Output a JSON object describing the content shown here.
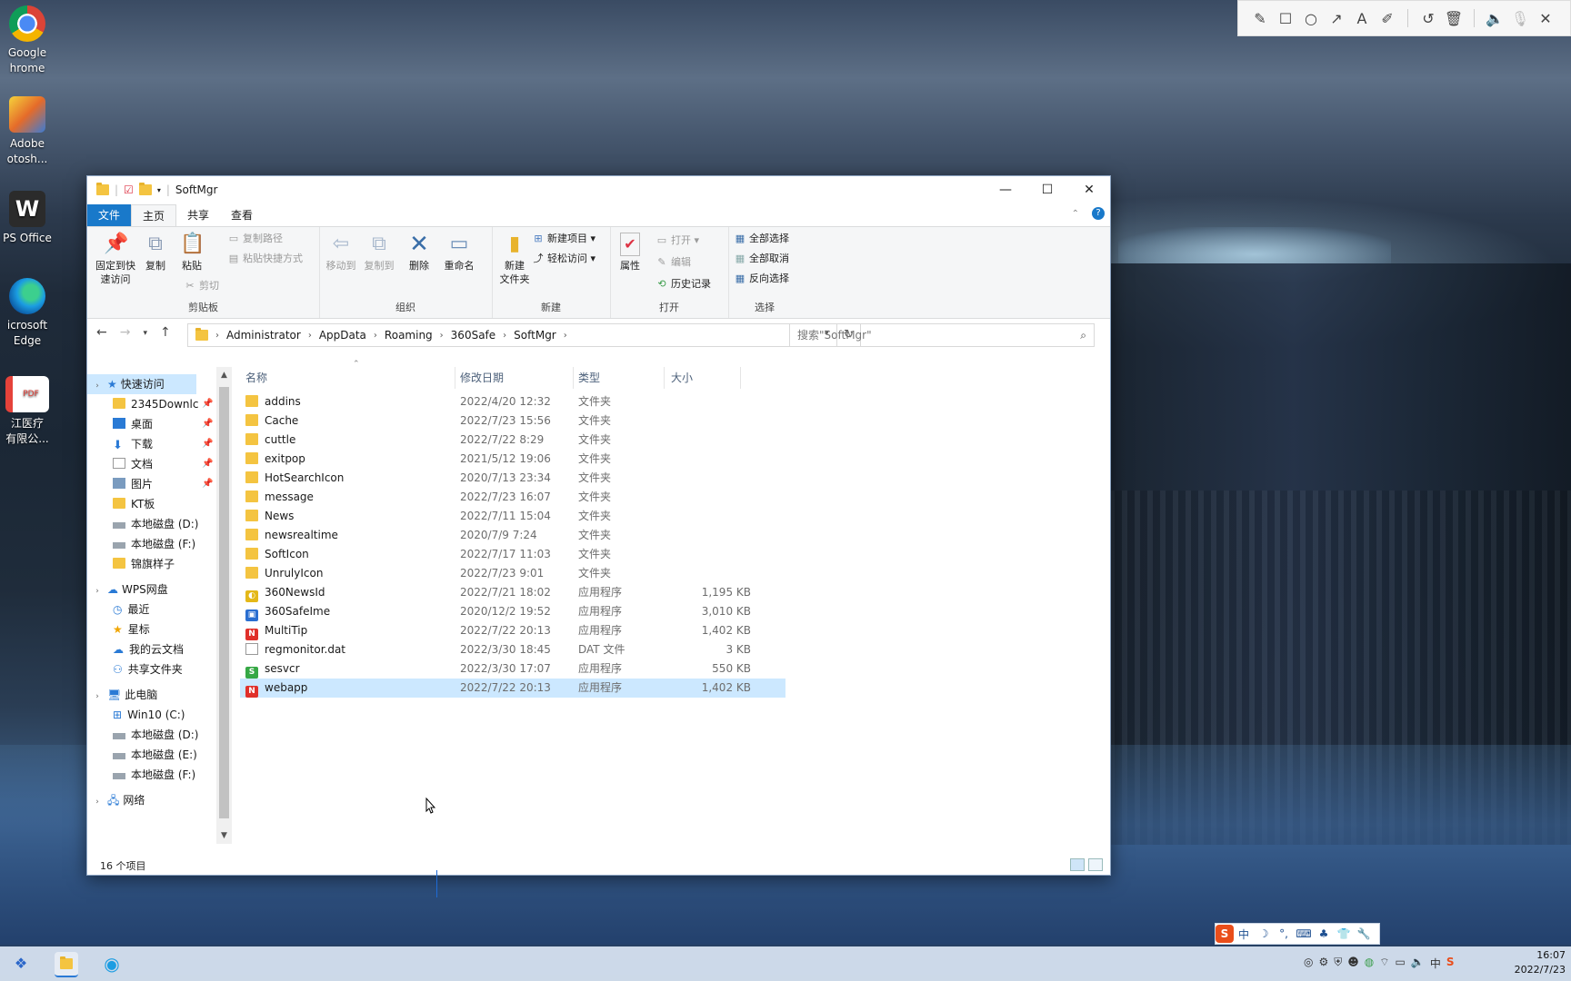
{
  "desktop": {
    "icons": [
      {
        "label": "Google Chrome",
        "lines": [
          "Google",
          "hrome"
        ]
      },
      {
        "label": "Adobe Photoshop",
        "lines": [
          "Adobe",
          "otosh..."
        ]
      },
      {
        "label": "WPS Office",
        "lines": [
          "PS Office"
        ]
      },
      {
        "label": "Microsoft Edge",
        "lines": [
          "icrosoft",
          "Edge"
        ]
      },
      {
        "label": "PDF",
        "lines": [
          "江医疗",
          "有限公..."
        ]
      }
    ]
  },
  "annotation_toolbar": {
    "tools": [
      "pencil-icon",
      "rectangle-icon",
      "ellipse-icon",
      "arrow-icon",
      "text-icon",
      "marker-icon",
      "undo-icon",
      "delete-icon",
      "volume-icon",
      "mic-icon",
      "close-icon"
    ]
  },
  "window": {
    "title": "SoftMgr",
    "tabs": {
      "file": "文件",
      "home": "主页",
      "share": "共享",
      "view": "查看"
    },
    "ribbon": {
      "clipboard": {
        "name": "剪贴板",
        "pin_label_1": "固定到快",
        "pin_label_2": "速访问",
        "copy": "复制",
        "paste": "粘贴",
        "copy_path": "复制路径",
        "paste_shortcut": "粘贴快捷方式",
        "cut": "剪切"
      },
      "organize": {
        "name": "组织",
        "move_to": "移动到",
        "copy_to": "复制到",
        "delete": "删除",
        "rename": "重命名"
      },
      "new": {
        "name": "新建",
        "new_folder_1": "新建",
        "new_folder_2": "文件夹",
        "new_item": "新建项目",
        "easy_access": "轻松访问"
      },
      "open": {
        "name": "打开",
        "properties": "属性",
        "open": "打开",
        "edit": "编辑",
        "history": "历史记录"
      },
      "select": {
        "name": "选择",
        "select_all": "全部选择",
        "select_none": "全部取消",
        "invert": "反向选择"
      }
    },
    "address": {
      "crumbs": [
        "Administrator",
        "AppData",
        "Roaming",
        "360Safe",
        "SoftMgr"
      ],
      "search_placeholder": "搜索\"SoftMgr\""
    },
    "nav_pane": {
      "quick_access": "快速访问",
      "quick_items": [
        {
          "label": "2345Downlc",
          "pinned": true
        },
        {
          "label": "桌面",
          "pinned": true
        },
        {
          "label": "下载",
          "pinned": true
        },
        {
          "label": "文档",
          "pinned": true
        },
        {
          "label": "图片",
          "pinned": true
        },
        {
          "label": "KT板",
          "pinned": false
        },
        {
          "label": "本地磁盘 (D:)",
          "pinned": false
        },
        {
          "label": "本地磁盘 (F:)",
          "pinned": false
        },
        {
          "label": "锦旗样子",
          "pinned": false
        }
      ],
      "wps": "WPS网盘",
      "wps_items": [
        "最近",
        "星标",
        "我的云文档",
        "共享文件夹"
      ],
      "this_pc": "此电脑",
      "pc_items": [
        "Win10 (C:)",
        "本地磁盘 (D:)",
        "本地磁盘 (E:)",
        "本地磁盘 (F:)"
      ],
      "network": "网络"
    },
    "columns": {
      "name": "名称",
      "date": "修改日期",
      "type": "类型",
      "size": "大小"
    },
    "files": [
      {
        "name": "addins",
        "date": "2022/4/20 12:32",
        "type": "文件夹",
        "size": "",
        "kind": "folder"
      },
      {
        "name": "Cache",
        "date": "2022/7/23 15:56",
        "type": "文件夹",
        "size": "",
        "kind": "folder"
      },
      {
        "name": "cuttle",
        "date": "2022/7/22 8:29",
        "type": "文件夹",
        "size": "",
        "kind": "folder"
      },
      {
        "name": "exitpop",
        "date": "2021/5/12 19:06",
        "type": "文件夹",
        "size": "",
        "kind": "folder"
      },
      {
        "name": "HotSearchIcon",
        "date": "2020/7/13 23:34",
        "type": "文件夹",
        "size": "",
        "kind": "folder"
      },
      {
        "name": "message",
        "date": "2022/7/23 16:07",
        "type": "文件夹",
        "size": "",
        "kind": "folder"
      },
      {
        "name": "News",
        "date": "2022/7/11 15:04",
        "type": "文件夹",
        "size": "",
        "kind": "folder"
      },
      {
        "name": "newsrealtime",
        "date": "2020/7/9 7:24",
        "type": "文件夹",
        "size": "",
        "kind": "folder"
      },
      {
        "name": "SoftIcon",
        "date": "2022/7/17 11:03",
        "type": "文件夹",
        "size": "",
        "kind": "folder"
      },
      {
        "name": "UnrulyIcon",
        "date": "2022/7/23 9:01",
        "type": "文件夹",
        "size": "",
        "kind": "folder"
      },
      {
        "name": "360NewsId",
        "date": "2022/7/21 18:02",
        "type": "应用程序",
        "size": "1,195 KB",
        "kind": "app-yellow"
      },
      {
        "name": "360SafeIme",
        "date": "2020/12/2 19:52",
        "type": "应用程序",
        "size": "3,010 KB",
        "kind": "app-blue"
      },
      {
        "name": "MultiTip",
        "date": "2022/7/22 20:13",
        "type": "应用程序",
        "size": "1,402 KB",
        "kind": "app-red"
      },
      {
        "name": "regmonitor.dat",
        "date": "2022/3/30 18:45",
        "type": "DAT 文件",
        "size": "3 KB",
        "kind": "doc"
      },
      {
        "name": "sesvcr",
        "date": "2022/3/30 17:07",
        "type": "应用程序",
        "size": "550 KB",
        "kind": "app-green"
      },
      {
        "name": "webapp",
        "date": "2022/7/22 20:13",
        "type": "应用程序",
        "size": "1,402 KB",
        "kind": "app-red"
      }
    ],
    "selected_index": 15,
    "status": "16 个项目"
  },
  "ime": {
    "labels": [
      "S",
      "中",
      "☽",
      "°,",
      "⌨",
      "♣",
      "👕",
      "🔧"
    ]
  },
  "taskbar": {
    "time": "16:07",
    "date": "2022/7/23"
  }
}
